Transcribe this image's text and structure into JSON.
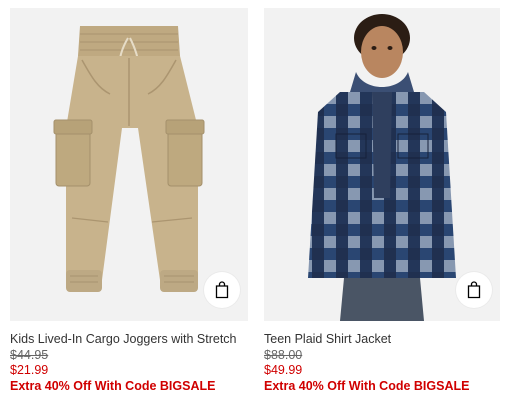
{
  "products": [
    {
      "name": "Kids Lived-In Cargo Joggers with Stretch",
      "original_price": "$44.95",
      "sale_price": "$21.99",
      "promo": "Extra 40% Off With Code BIGSALE",
      "image_icon": "khaki-cargo-joggers",
      "bag_icon": "shopping-bag-icon"
    },
    {
      "name": "Teen Plaid Shirt Jacket",
      "original_price": "$88.00",
      "sale_price": "$49.99",
      "promo": "Extra 40% Off With Code BIGSALE",
      "image_icon": "plaid-shirt-jacket-model",
      "bag_icon": "shopping-bag-icon"
    }
  ],
  "colors": {
    "image_bg": "#f2f2f2",
    "sale_red": "#d00000",
    "text": "#333333",
    "strike": "#666666",
    "khaki": "#c8b38c",
    "plaid_blue": "#3d6fb0",
    "plaid_navy": "#1e2b4a",
    "plaid_gray": "#9aa3b2"
  }
}
